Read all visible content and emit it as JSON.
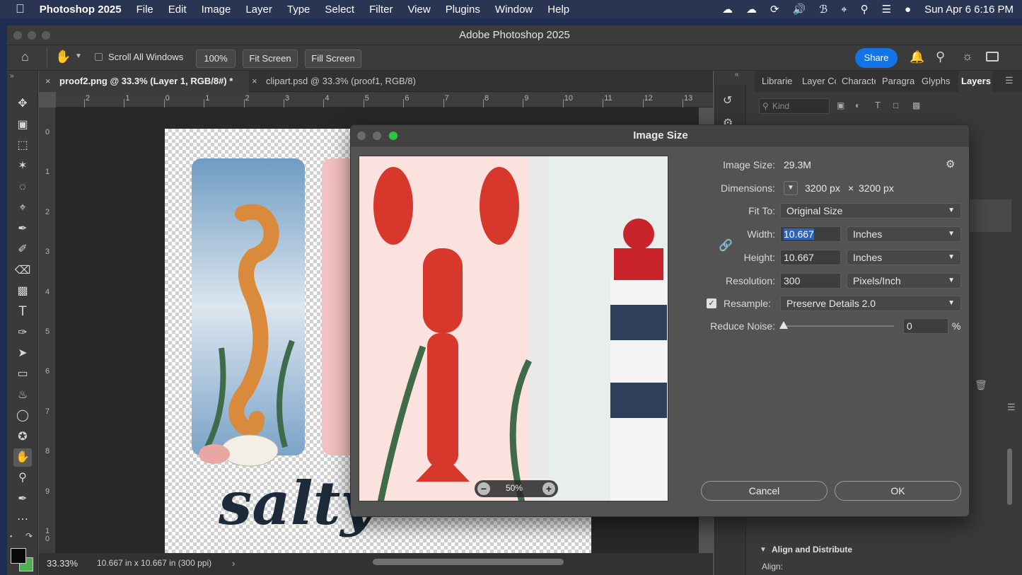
{
  "menubar": {
    "app_name": "Photoshop 2025",
    "items": [
      "File",
      "Edit",
      "Image",
      "Layer",
      "Type",
      "Select",
      "Filter",
      "View",
      "Plugins",
      "Window",
      "Help"
    ],
    "clock": "Sun Apr 6  6:16 PM"
  },
  "window": {
    "title": "Adobe Photoshop 2025"
  },
  "options_bar": {
    "scroll_all_windows": "Scroll All Windows",
    "zoom_button": "100%",
    "fit_screen": "Fit Screen",
    "fill_screen": "Fill Screen",
    "share": "Share"
  },
  "tabs": [
    {
      "label": "proof2.png @ 33.3% (Layer 1, RGB/8#) *"
    },
    {
      "label": "clipart.psd @ 33.3% (proof1, RGB/8)"
    }
  ],
  "ruler": {
    "top": [
      "2",
      "1",
      "0",
      "1",
      "2",
      "3",
      "4",
      "5",
      "6",
      "7",
      "8",
      "9",
      "10",
      "11",
      "12",
      "13"
    ],
    "left": [
      "0",
      "1",
      "2",
      "3",
      "4",
      "5",
      "6",
      "7",
      "8",
      "9",
      "1\n0"
    ]
  },
  "status": {
    "zoom": "33.33%",
    "info": "10.667 in x 10.667 in (300 ppi)"
  },
  "panel_tabs": [
    "Librarie",
    "Layer Co",
    "Characte",
    "Paragra",
    "Glyphs",
    "Layers"
  ],
  "layers_panel": {
    "kind_placeholder": "Kind"
  },
  "properties_panel": {
    "align_heading": "Align and Distribute",
    "align_label": "Align:"
  },
  "canvas": {
    "artwork_text": "salty"
  },
  "dialog": {
    "title": "Image Size",
    "image_size_label": "Image Size:",
    "image_size_value": "29.3M",
    "dimensions_label": "Dimensions:",
    "dim_width": "3200 px",
    "dim_x": "×",
    "dim_height": "3200 px",
    "fit_to_label": "Fit To:",
    "fit_to_value": "Original Size",
    "width_label": "Width:",
    "width_value": "10.667",
    "width_unit": "Inches",
    "height_label": "Height:",
    "height_value": "10.667",
    "height_unit": "Inches",
    "resolution_label": "Resolution:",
    "resolution_value": "300",
    "resolution_unit": "Pixels/Inch",
    "resample_label": "Resample:",
    "resample_checked": true,
    "resample_value": "Preserve Details 2.0",
    "reduce_noise_label": "Reduce Noise:",
    "reduce_noise_value": "0",
    "reduce_noise_unit": "%",
    "preview_zoom": "50%",
    "cancel": "Cancel",
    "ok": "OK"
  },
  "colors": {
    "accent": "#1473e6",
    "panel": "#535353",
    "menubar": "#2a3453"
  }
}
